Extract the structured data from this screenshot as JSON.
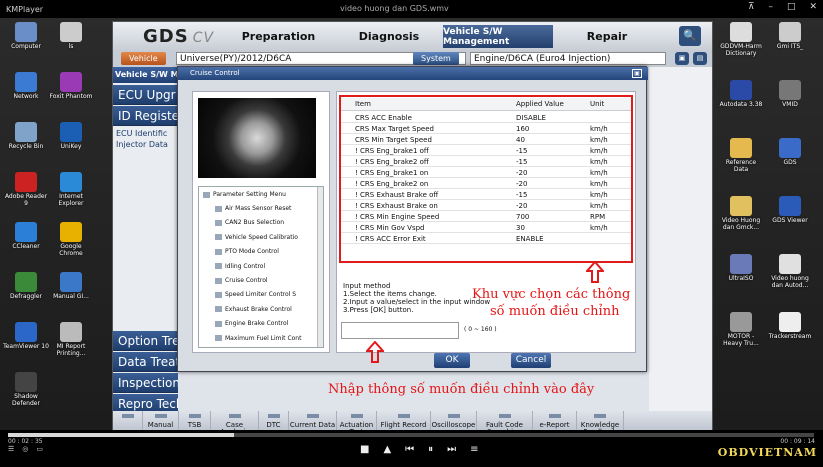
{
  "player": {
    "app_name": "KMPlayer",
    "video_title": "video huong dan GDS.wmv",
    "time_elapsed": "00 : 02 : 35",
    "time_total": "00 : 09 : 14",
    "progress": 0.28,
    "tool_labels": [
      "",
      ""
    ],
    "watermark": "OBDVIETNAM"
  },
  "desktop_icons_left": [
    {
      "label": "Computer"
    },
    {
      "label": "Network"
    },
    {
      "label": "Recycle Bin"
    },
    {
      "label": "Adobe Reader 9"
    },
    {
      "label": "CCleaner"
    },
    {
      "label": "Defraggler"
    },
    {
      "label": "TeamViewer 10"
    },
    {
      "label": "Shadow Defender"
    }
  ],
  "desktop_icons_left2": [
    {
      "label": "ls"
    },
    {
      "label": "Foxit Phantom"
    },
    {
      "label": "UniKey"
    },
    {
      "label": "Internet Explorer"
    },
    {
      "label": "Google Chrome"
    },
    {
      "label": "Manual GI..."
    },
    {
      "label": "MI Report Printing..."
    }
  ],
  "desktop_icons_right": [
    {
      "label": "GDDVM-Harm Dictionary"
    },
    {
      "label": "Autodata 3.38"
    },
    {
      "label": "Reference Data"
    },
    {
      "label": "Video Huong dan Gmck..."
    },
    {
      "label": "UltraISO"
    },
    {
      "label": "MOTOR - Heavy Tru..."
    }
  ],
  "desktop_icons_right2": [
    {
      "label": "Gmi ITS_"
    },
    {
      "label": "VMID"
    },
    {
      "label": "GDS"
    },
    {
      "label": "GDS Viewer"
    },
    {
      "label": "Video huong dan Autod..."
    },
    {
      "label": "Trackerstream"
    }
  ],
  "gds": {
    "logo": "GDS",
    "logo_suffix": "CV",
    "menu": [
      "Preparation",
      "Diagnosis",
      "Vehicle S/W Management",
      "Repair"
    ],
    "vehicle_label": "Vehicle",
    "vehicle_value": "Universe(PY)/2012/D6CA",
    "system_label": "System",
    "system_value": "Engine/D6CA (Euro4 Injection)",
    "left_header": "Vehicle S/W M",
    "left_items": [
      "ECU Upgr",
      "ID Registe",
      "Option Treatm",
      "Data Treatm",
      "Inspection / Test",
      "Repro Tech"
    ],
    "left_subitems": [
      "ECU Identific",
      "Injector Data"
    ],
    "toolbar": [
      "Manual",
      "TSB",
      "Case Analysis",
      "DTC",
      "Current Data",
      "Actuation Test",
      "Flight Record",
      "Oscilloscope",
      "Fault Code Searching",
      "e-Report",
      "Knowledge Feedback"
    ]
  },
  "dialog": {
    "title": "Cruise Control",
    "tree_root": "Parameter Setting Menu",
    "tree_items": [
      "Air Mass Sensor Reset",
      "CAN2 Bus Selection",
      "Vehicle Speed Calibratio",
      "PTO Mode Control",
      "Idling Control",
      "Cruise Control",
      "Speed Limiter Control S",
      "Exhaust Brake Control",
      "Engine Brake Control",
      "Maximum Fuel Limit Cont"
    ],
    "table_headers": [
      "Item",
      "Applied Value",
      "Unit"
    ],
    "rows": [
      {
        "item": "CRS ACC Enable",
        "value": "DISABLE",
        "unit": ""
      },
      {
        "item": "CRS Max Target Speed",
        "value": "160",
        "unit": "km/h"
      },
      {
        "item": "CRS Min Target Speed",
        "value": "40",
        "unit": "km/h"
      },
      {
        "item": "! CRS Eng_brake1 off",
        "value": "-15",
        "unit": "km/h"
      },
      {
        "item": "! CRS Eng_brake2 off",
        "value": "-15",
        "unit": "km/h"
      },
      {
        "item": "! CRS Eng_brake1 on",
        "value": "-20",
        "unit": "km/h"
      },
      {
        "item": "! CRS Eng_brake2 on",
        "value": "-20",
        "unit": "km/h"
      },
      {
        "item": "! CRS Exhaust Brake off",
        "value": "-15",
        "unit": "km/h"
      },
      {
        "item": "! CRS Exhaust Brake on",
        "value": "-20",
        "unit": "km/h"
      },
      {
        "item": "! CRS Min Engine Speed",
        "value": "700",
        "unit": "RPM"
      },
      {
        "item": "! CRS Min Gov Vspd",
        "value": "30",
        "unit": "km/h"
      },
      {
        "item": "! CRS ACC Error Exit",
        "value": "ENABLE",
        "unit": ""
      }
    ],
    "help_title": "Input method",
    "help_lines": [
      "1.Select the items change.",
      "2.Input a value/select in the input window",
      "3.Press [OK] button."
    ],
    "input_value": "",
    "range": "( 0 ~ 160 )",
    "ok": "OK",
    "cancel": "Cancel"
  },
  "annotations": {
    "box_note_line1": "Khu vực chọn các thông",
    "box_note_line2": "số muốn điều chỉnh",
    "input_note": "Nhập thông số muốn điều chỉnh vào đây",
    "color": "#e01b1b"
  }
}
